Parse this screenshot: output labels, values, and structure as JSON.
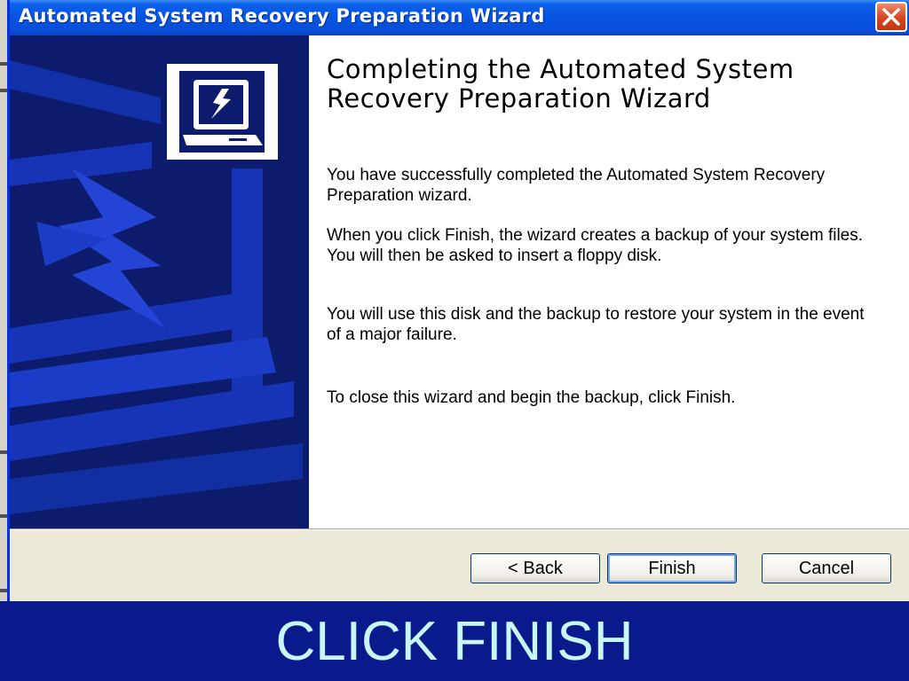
{
  "window": {
    "title": "Automated System Recovery Preparation Wizard"
  },
  "page": {
    "heading": "Completing the Automated System Recovery Preparation Wizard",
    "paragraphs": [
      "You have successfully completed the Automated System Recovery Preparation wizard.",
      "When you click Finish, the wizard creates a backup of your system files. You will then be asked to insert a floppy disk.",
      "You will use this disk and the backup to restore your system in the event of a major failure.",
      "To close this wizard and begin the backup, click Finish."
    ]
  },
  "buttons": {
    "back": "< Back",
    "finish": "Finish",
    "cancel": "Cancel"
  },
  "caption": "CLICK FINISH",
  "icons": {
    "close": "close-icon",
    "wizard_logo": "computer-lightning-icon"
  },
  "colors": {
    "titlebar": "#0551e0",
    "banner": "#0c1b6b",
    "caption_bg": "#0a1a8c",
    "caption_text": "#c8f7f7"
  }
}
